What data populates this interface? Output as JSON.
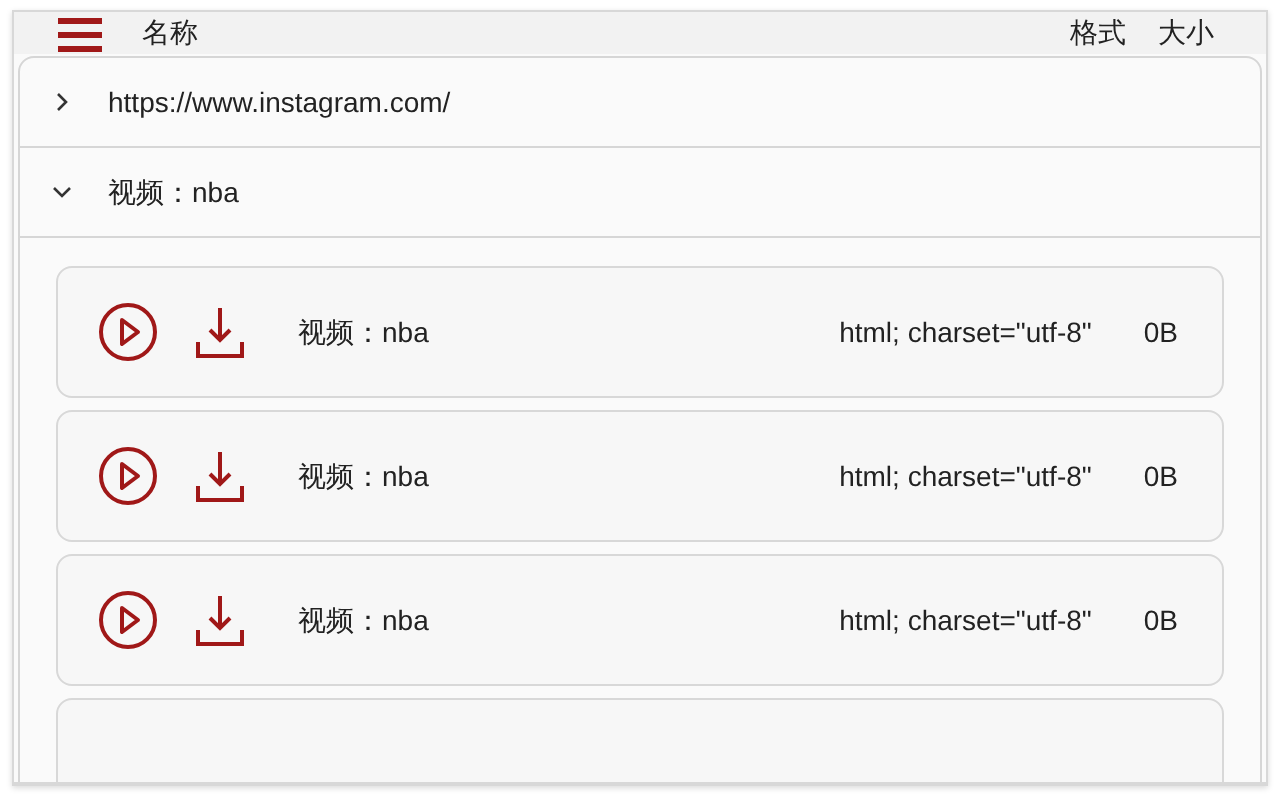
{
  "header": {
    "title": "名称",
    "columns": [
      "格式",
      "大小"
    ]
  },
  "groups": [
    {
      "label": "https://www.instagram.com/",
      "expanded": false
    },
    {
      "label": "视频：nba",
      "expanded": true,
      "children": [
        {
          "name": "视频：nba",
          "format": "html; charset=\"utf-8\"",
          "size": "0B"
        },
        {
          "name": "视频：nba",
          "format": "html; charset=\"utf-8\"",
          "size": "0B"
        },
        {
          "name": "视频：nba",
          "format": "html; charset=\"utf-8\"",
          "size": "0B"
        }
      ]
    }
  ]
}
